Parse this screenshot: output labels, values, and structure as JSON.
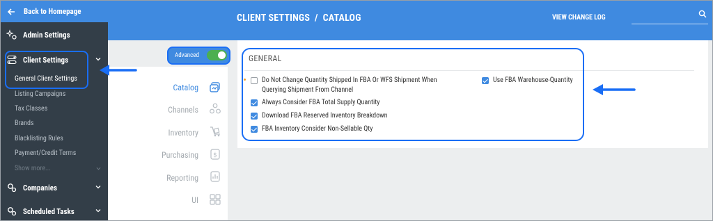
{
  "sidebar": {
    "back_label": "Back to Homepage",
    "items": [
      {
        "label": "Admin Settings",
        "icon": "sparkle-gear-icon"
      },
      {
        "label": "Client Settings",
        "icon": "toggles-icon"
      },
      {
        "label": "Companies",
        "icon": "gears-icon"
      },
      {
        "label": "Scheduled Tasks",
        "icon": "gears-icon"
      }
    ],
    "sub_items": [
      {
        "label": "General Client Settings",
        "active": true
      },
      {
        "label": "Listing Campaigns"
      },
      {
        "label": "Tax Classes"
      },
      {
        "label": "Brands"
      },
      {
        "label": "Blacklisting Rules"
      },
      {
        "label": "Payment/Credit Terms"
      },
      {
        "label": "Show more..."
      }
    ]
  },
  "header": {
    "title": "CLIENT SETTINGS  /  CATALOG",
    "change_log": "VIEW CHANGE LOG",
    "search_placeholder": ""
  },
  "advanced": {
    "label": "Advanced",
    "on": true
  },
  "nav": [
    {
      "label": "Catalog",
      "icon": "catalog-icon",
      "active": true
    },
    {
      "label": "Channels",
      "icon": "channels-icon"
    },
    {
      "label": "Inventory",
      "icon": "inventory-icon"
    },
    {
      "label": "Purchasing",
      "icon": "purchasing-icon"
    },
    {
      "label": "Reporting",
      "icon": "reporting-icon"
    },
    {
      "label": "UI",
      "icon": "ui-grid-icon"
    }
  ],
  "section": {
    "title": "GENERAL",
    "options": [
      {
        "label": "Do Not Change Quantity Shipped In FBA Or WFS Shipment When",
        "label2": "Querying Shipment From Channel",
        "checked": false
      },
      {
        "label": "Always Consider FBA Total Supply Quantity",
        "checked": true
      },
      {
        "label": "Download FBA Reserved Inventory Breakdown",
        "checked": true
      },
      {
        "label": "FBA Inventory Consider Non-Sellable Qty",
        "checked": true
      },
      {
        "label": "Use FBA Warehouse-Quantity",
        "checked": true
      }
    ]
  },
  "colors": {
    "accent": "#3f8ae0",
    "sidebar": "#333e48",
    "highlight": "#1a6ef5",
    "toggle": "#4caf50"
  }
}
